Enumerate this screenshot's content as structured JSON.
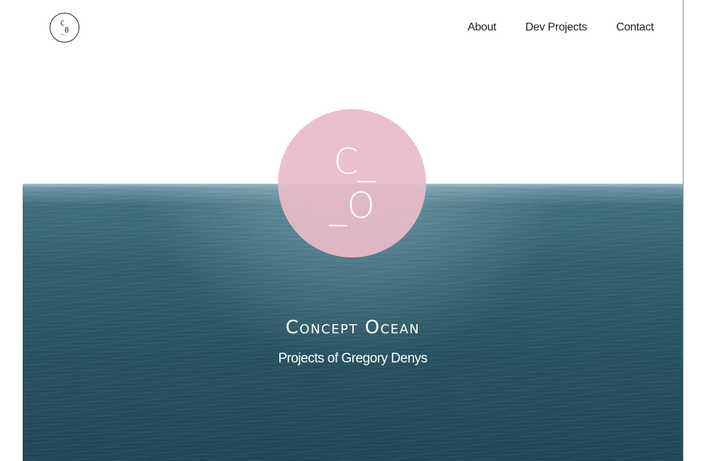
{
  "header": {
    "logo": {
      "line1": "C_",
      "line2": "_0"
    },
    "nav": [
      {
        "label": "About"
      },
      {
        "label": "Dev Projects"
      },
      {
        "label": "Contact"
      }
    ]
  },
  "hero": {
    "emblem": {
      "line1": "C_",
      "line2": "_O",
      "color": "#e8bbc9"
    },
    "title": "Concept Ocean",
    "subtitle": "Projects of Gregory Denys",
    "background_color": "#2a5a6a"
  }
}
